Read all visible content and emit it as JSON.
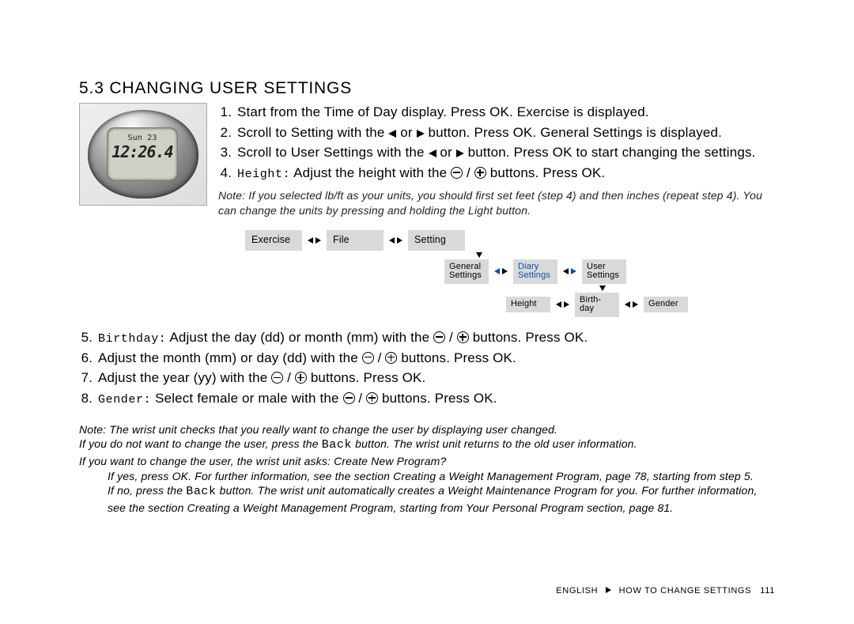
{
  "heading": "5.3 CHANGING USER SETTINGS",
  "watch": {
    "date": "Sun 23",
    "time": "12:26.4"
  },
  "steps_a": {
    "s1": "Start from the Time of Day display. Press OK. Exercise is displayed.",
    "s2a": "Scroll to Setting with the ",
    "s2b": " or ",
    "s2c": " button. Press OK. General Settings is displayed.",
    "s3a": "Scroll to User Settings with the ",
    "s3b": " or ",
    "s3c": " button. Press OK to start changing the settings.",
    "s4_label": "Height:",
    "s4a": " Adjust the height with the ",
    "s4b": " / ",
    "s4c": " buttons. Press OK."
  },
  "note1a": "Note: If you selected lb/ft as your units, you should first set feet (step 4) and then inches (repeat step 4). You can change the units by pressing and holding the Light button.",
  "menu": {
    "exercise": "Exercise",
    "file": "File",
    "setting": "Setting",
    "general": "General\nSettings",
    "diary": "Diary\nSettings",
    "user": "User\nSettings",
    "height": "Height",
    "birthday": "Birth-\nday",
    "gender": "Gender"
  },
  "steps_b": {
    "s5_label": "Birthday:",
    "s5a": " Adjust the day (dd) or month (mm) with the ",
    "s5b": " / ",
    "s5c": "  buttons. Press OK.",
    "s6a": "Adjust the month (mm) or day (dd) with the ",
    "s6b": " / ",
    "s6c": " buttons. Press OK.",
    "s7a": "Adjust the year (yy) with the ",
    "s7b": " / ",
    "s7c": " buttons. Press OK.",
    "s8_label": "Gender:",
    "s8a": " Select female or male with the ",
    "s8b": " / ",
    "s8c": " buttons. Press OK."
  },
  "note2_l1": "Note: The wrist unit checks that you really want to change the user by displaying user changed.",
  "note2_l2a": "If you do not want to change the user, press the ",
  "note2_l2_back": "Back",
  "note2_l2b": " button. The wrist unit returns to the old user information.",
  "note2_l3": "If you want to change the user, the wrist unit asks: Create New Program?",
  "note2_l4": "If yes, press OK. For further information, see the section Creating a Weight Management Program, page 78, starting from step 5.",
  "note2_l5a": "If no, press the ",
  "note2_l5_back": "Back",
  "note2_l5b": " button. The wrist unit automatically creates a Weight Maintenance Program for you. For further information, see the section Creating a Weight Management Program, starting from Your Personal Program section, page 81.",
  "footer": {
    "lang": "ENGLISH",
    "section": "HOW TO CHANGE SETTINGS",
    "page": "111"
  }
}
